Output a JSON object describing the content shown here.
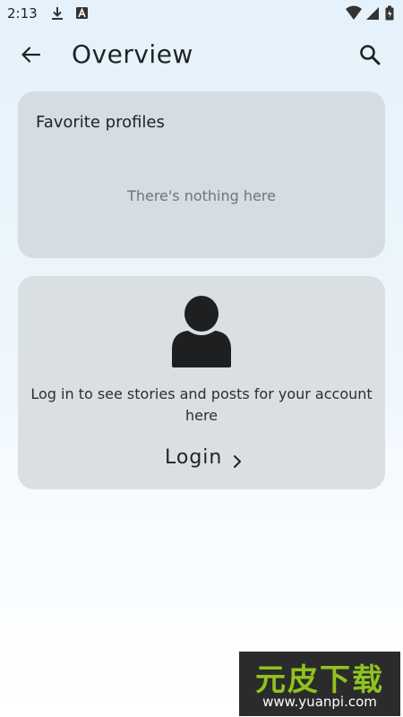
{
  "status_bar": {
    "time": "2:13",
    "icons": [
      "download-icon",
      "a-badge-icon",
      "wifi-icon",
      "cellular-signal-icon",
      "battery-icon"
    ]
  },
  "top_bar": {
    "title": "Overview",
    "back_icon": "arrow-left-icon",
    "search_icon": "search-icon"
  },
  "favorites_card": {
    "title": "Favorite profiles",
    "empty_text": "There's nothing here"
  },
  "login_card": {
    "icon": "person-icon",
    "message": "Log in to see stories and posts for your account here",
    "button_label": "Login",
    "button_icon": "chevron-right-icon"
  },
  "watermark": {
    "logo_text": "元皮下载",
    "url": "www.yuanpi.com",
    "logo_color": "#8fc31f"
  }
}
